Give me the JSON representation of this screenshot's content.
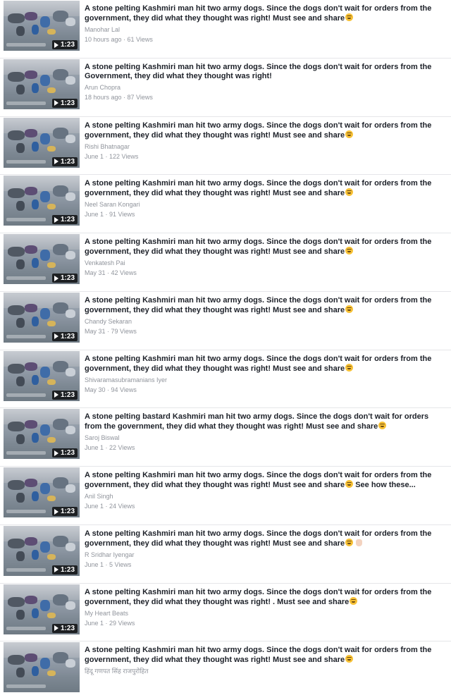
{
  "items": [
    {
      "title": "A stone pelting Kashmiri man hit two army dogs. Since the dogs don't wait for orders from the government, they did what they thought was right! Must see and share",
      "emoji": true,
      "suffix": "",
      "hand": false,
      "author": "Manohar Lal",
      "meta": "10 hours ago · 61 Views",
      "duration": "1:23"
    },
    {
      "title": "A stone pelting Kashmiri man hit two army dogs. Since the dogs don't wait for orders from the Government, they did what they thought was right!",
      "emoji": false,
      "suffix": "",
      "hand": false,
      "author": "Arun Chopra",
      "meta": "18 hours ago · 87 Views",
      "duration": "1:23"
    },
    {
      "title": "A stone pelting Kashmiri man hit two army dogs. Since the dogs don't wait for orders from the government, they did what they thought was right! Must see and share",
      "emoji": true,
      "suffix": "",
      "hand": false,
      "author": "Rishi Bhatnagar",
      "meta": "June 1 · 122 Views",
      "duration": "1:23"
    },
    {
      "title": "A stone pelting Kashmiri man hit two army dogs. Since the dogs don't wait for orders from the government, they did what they thought was right! Must see and share",
      "emoji": true,
      "suffix": "",
      "hand": false,
      "author": "Neel Saran Kongari",
      "meta": "June 1 · 91 Views",
      "duration": "1:23"
    },
    {
      "title": "A stone pelting Kashmiri man hit two army dogs. Since the dogs don't wait for orders from the government, they did what they thought was right! Must see and share",
      "emoji": true,
      "suffix": "",
      "hand": false,
      "author": "Venkatesh Pai",
      "meta": "May 31 · 42 Views",
      "duration": "1:23"
    },
    {
      "title": "A stone pelting Kashmiri man hit two army dogs. Since the dogs don't wait for orders from the government, they did what they thought was right! Must see and share",
      "emoji": true,
      "suffix": "",
      "hand": false,
      "author": "Chandy Sekaran",
      "meta": "May 31 · 79 Views",
      "duration": "1:23"
    },
    {
      "title": "A stone pelting Kashmiri man hit two army dogs. Since the dogs don't wait for orders from the government, they did what they thought was right! Must see and share",
      "emoji": true,
      "suffix": "",
      "hand": false,
      "author": "Shivaramasubramanians Iyer",
      "meta": "May 30 · 94 Views",
      "duration": "1:23"
    },
    {
      "title": "A stone pelting bastard Kashmiri man hit two army dogs. Since the dogs don't wait for orders from the government, they did what they thought was right! Must see and share",
      "emoji": true,
      "suffix": "",
      "hand": false,
      "author": "Saroj Biswal",
      "meta": "June 1 · 22 Views",
      "duration": "1:23"
    },
    {
      "title": "A stone pelting Kashmiri man hit two army dogs. Since the dogs don't wait for orders from the government, they did what they thought was right! Must see and share",
      "emoji": true,
      "suffix": " See how these...",
      "hand": false,
      "author": "Anil Singh",
      "meta": "June 1 · 24 Views",
      "duration": "1:23"
    },
    {
      "title": "A stone pelting Kashmiri man hit two army dogs. Since the dogs don't wait for orders from the government, they did what they thought was right! Must see and share",
      "emoji": true,
      "suffix": "",
      "hand": true,
      "author": "R Sridhar Iyengar",
      "meta": "June 1 · 5 Views",
      "duration": "1:23"
    },
    {
      "title": "A stone pelting Kashmiri man hit two army dogs. Since the dogs don't wait for orders from the government, they did what they thought was right! . Must see and share",
      "emoji": true,
      "suffix": "",
      "hand": false,
      "author": "My Heart Beats",
      "meta": "June 1 · 29 Views",
      "duration": "1:23"
    },
    {
      "title": "A stone pelting Kashmiri man hit two army dogs. Since the dogs don't wait for orders from the government, they did what they thought was right! Must see and share",
      "emoji": true,
      "suffix": "",
      "hand": false,
      "author": "हिंदू गणपत सिंह राजपुरोहित",
      "meta": "",
      "duration": ""
    }
  ],
  "icons": {
    "play": "play-icon",
    "emoji": "grinning-face-emoji-icon",
    "hand": "ok-hand-emoji-icon"
  }
}
